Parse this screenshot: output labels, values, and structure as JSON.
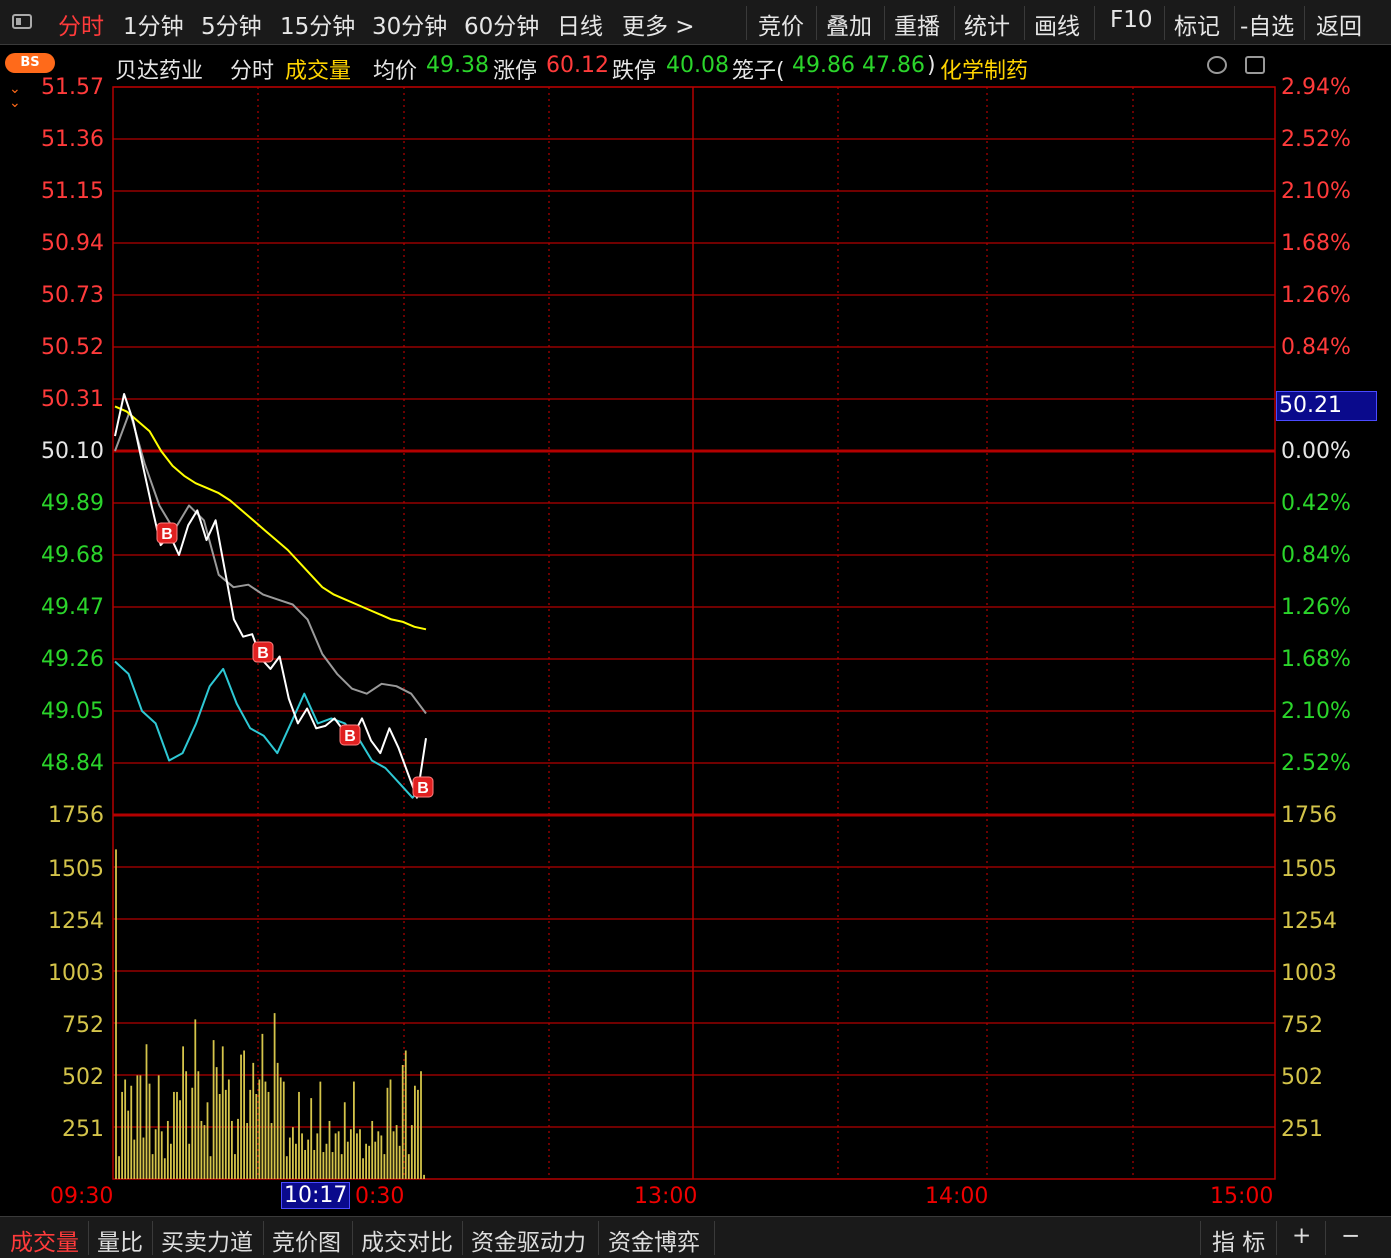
{
  "toolbar": {
    "left_items": [
      "分时",
      "1分钟",
      "5分钟",
      "15分钟",
      "30分钟",
      "60分钟",
      "日线",
      "更多 >"
    ],
    "right_items": [
      "竞价",
      "叠加",
      "重播",
      "统计",
      "画线",
      "F10",
      "标记",
      "-自选",
      "返回"
    ]
  },
  "info": {
    "badge": "BS",
    "stock_name": "贝达药业",
    "mode": "分时",
    "indicator": "成交量",
    "avg_label": "均价",
    "avg_value": "49.38",
    "limit_up_label": "涨停",
    "limit_up_value": "60.12",
    "limit_down_label": "跌停",
    "limit_down_value": "40.08",
    "cage_label": "笼子(",
    "cage_value1": "49.86",
    "cage_value2": "47.86",
    "cage_close": ")",
    "sector": "化学制药"
  },
  "price_axis_left": [
    "51.57",
    "51.36",
    "51.15",
    "50.94",
    "50.73",
    "50.52",
    "50.31",
    "50.10",
    "49.89",
    "49.68",
    "49.47",
    "49.26",
    "49.05",
    "48.84"
  ],
  "pct_axis_right": [
    "2.94%",
    "2.52%",
    "2.10%",
    "1.68%",
    "1.26%",
    "0.84%",
    "",
    "0.00%",
    "0.42%",
    "0.84%",
    "1.26%",
    "1.68%",
    "2.10%",
    "2.52%"
  ],
  "current_price": "50.21",
  "volume_axis": [
    "1756",
    "1505",
    "1254",
    "1003",
    "752",
    "502",
    "251"
  ],
  "x_axis": {
    "open": "09:30",
    "cursor": "10:17",
    "t1030": "0:30",
    "t1300": "13:00",
    "t1400": "14:00",
    "t1500": "15:00"
  },
  "bottom_tabs": [
    "成交量",
    "量比",
    "买卖力道",
    "竞价图",
    "成交对比",
    "资金驱动力",
    "资金博弈"
  ],
  "bottom_right": {
    "indicator": "指 标",
    "plus": "+",
    "minus": "−"
  },
  "markers": [
    "B",
    "B",
    "B",
    "B"
  ],
  "colors": {
    "up": "#ff3b3b",
    "down": "#2bd52b",
    "avg_line": "#ffff00",
    "volume": "#d4c44a",
    "grid": "#b40000",
    "cyan_line": "#2ec8d4"
  },
  "chart_data": {
    "type": "line",
    "price_ylim": [
      48.63,
      51.57
    ],
    "prev_close": 50.1,
    "series": [
      {
        "values": [
          50.16,
          50.33,
          50.22,
          50.05,
          49.88,
          49.72,
          49.76,
          49.68,
          49.8,
          49.86,
          49.74,
          49.82,
          49.62,
          49.42,
          49.35,
          49.36,
          49.26,
          49.22,
          49.27,
          49.1,
          49.0,
          49.06,
          48.98,
          48.99,
          49.02,
          48.97,
          48.95,
          49.02,
          48.93,
          48.88,
          48.98,
          48.9,
          48.8,
          48.7,
          48.94
        ]
      },
      {
        "values": [
          50.28,
          50.26,
          50.22,
          50.18,
          50.1,
          50.04,
          50.0,
          49.97,
          49.95,
          49.93,
          49.9,
          49.86,
          49.82,
          49.78,
          49.74,
          49.7,
          49.65,
          49.6,
          49.55,
          49.52,
          49.5,
          49.48,
          49.46,
          49.44,
          49.42,
          49.41,
          49.39,
          49.38
        ]
      },
      {
        "values": [
          50.1,
          50.26,
          50.05,
          49.88,
          49.78,
          49.88,
          49.82,
          49.6,
          49.55,
          49.56,
          49.52,
          49.5,
          49.48,
          49.42,
          49.28,
          49.2,
          49.14,
          49.12,
          49.16,
          49.15,
          49.12,
          49.04
        ]
      },
      {
        "values": [
          49.25,
          49.2,
          49.05,
          49.0,
          48.85,
          48.88,
          49.0,
          49.15,
          49.22,
          49.08,
          48.98,
          48.95,
          48.88,
          49.0,
          49.12,
          49.0,
          49.02,
          49.0,
          48.94,
          48.85,
          48.82,
          48.76,
          48.7,
          48.76
        ]
      }
    ],
    "volume_ylim": [
      0,
      1756
    ],
    "volume": [
      1590,
      110,
      420,
      480,
      330,
      450,
      190,
      500,
      500,
      200,
      650,
      460,
      120,
      240,
      500,
      230,
      100,
      280,
      170,
      420,
      420,
      380,
      640,
      520,
      170,
      440,
      770,
      520,
      280,
      260,
      370,
      110,
      670,
      540,
      410,
      640,
      430,
      480,
      280,
      120,
      290,
      600,
      620,
      270,
      430,
      560,
      410,
      480,
      700,
      470,
      420,
      270,
      800,
      560,
      490,
      470,
      110,
      200,
      250,
      170,
      420,
      220,
      140,
      190,
      390,
      140,
      220,
      470,
      130,
      170,
      280,
      130,
      220,
      230,
      120,
      370,
      180,
      240,
      470,
      220,
      240,
      100,
      170,
      160,
      280,
      180,
      230,
      210,
      120,
      440,
      480,
      230,
      260,
      160,
      550,
      620,
      120,
      260,
      450,
      430,
      520,
      20
    ]
  }
}
